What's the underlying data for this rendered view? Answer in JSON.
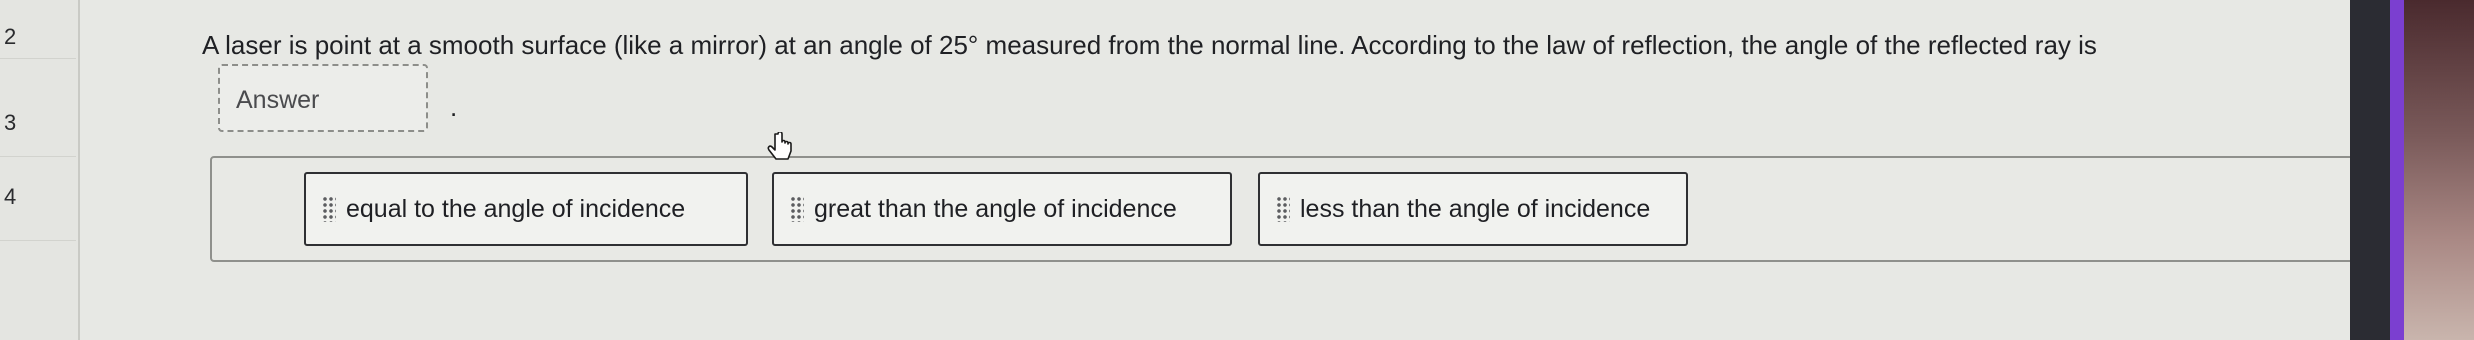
{
  "question_nav": [
    "2",
    "3",
    "4"
  ],
  "prompt": "A laser is point at a smooth surface (like a mirror) at an angle of 25° measured from the normal line. According to the law of reflection, the angle of the reflected ray is",
  "answer_blank": {
    "placeholder": "Answer"
  },
  "after_blank": ".",
  "options": [
    "equal to the angle of incidence",
    "great than the angle of incidence",
    "less than the angle of incidence"
  ],
  "icons": {
    "drag_handle": "drag-grip-icon",
    "cursor": "hand-pointer-icon"
  },
  "colors": {
    "background": "#e7e8e4",
    "accent_strip": "#7b3fd0"
  }
}
